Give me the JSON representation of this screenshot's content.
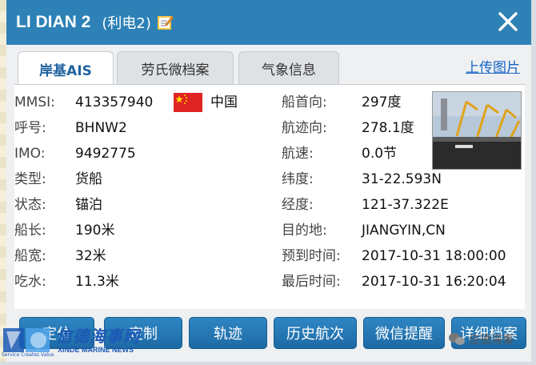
{
  "title": {
    "ship_name": "LI DIAN 2",
    "ship_name_cn": "(利电2)"
  },
  "tabs": [
    {
      "label": "岸基AIS",
      "active": true
    },
    {
      "label": "劳氏微档案",
      "active": false
    },
    {
      "label": "气象信息",
      "active": false
    }
  ],
  "upload_link": "上传图片",
  "left_fields": [
    {
      "label": "MMSI:",
      "value": "413357940"
    },
    {
      "label": "呼号:",
      "value": "BHNW2"
    },
    {
      "label": "IMO:",
      "value": "9492775"
    },
    {
      "label": "类型:",
      "value": "货船"
    },
    {
      "label": "状态:",
      "value": "锚泊"
    },
    {
      "label": "船长:",
      "value": "190米"
    },
    {
      "label": "船宽:",
      "value": "32米"
    },
    {
      "label": "吃水:",
      "value": "11.3米"
    }
  ],
  "country": "中国",
  "right_fields": [
    {
      "label": "船首向:",
      "value": "297度"
    },
    {
      "label": "航迹向:",
      "value": "278.1度"
    },
    {
      "label": "航速:",
      "value": "0.0节"
    },
    {
      "label": "纬度:",
      "value": "31-22.593N"
    },
    {
      "label": "经度:",
      "value": "121-37.322E"
    },
    {
      "label": "目的地:",
      "value": "JIANGYIN,CN"
    },
    {
      "label": "预到时间:",
      "value": "2017-10-31 18:00:00"
    },
    {
      "label": "最后时间:",
      "value": "2017-10-31 16:20:04"
    }
  ],
  "buttons": [
    {
      "label": "定位"
    },
    {
      "label": "定制"
    },
    {
      "label": "轨迹"
    },
    {
      "label": "历史航次"
    },
    {
      "label": "微信提醒"
    },
    {
      "label": "详细档案"
    }
  ],
  "watermark": {
    "brand": "信德海事网",
    "brand_en": "XINDE MARINE NEWS",
    "tagline": "Service Creates Value",
    "wechat": "信德海事"
  },
  "colors": {
    "titlebar": "#2d81b6",
    "button": "#1d6aa5",
    "link": "#1a63c7",
    "flag": "#e02424"
  },
  "icons": [
    "edit-icon",
    "close-icon",
    "flag-cn-icon",
    "ship-photo",
    "wechat-icon"
  ]
}
